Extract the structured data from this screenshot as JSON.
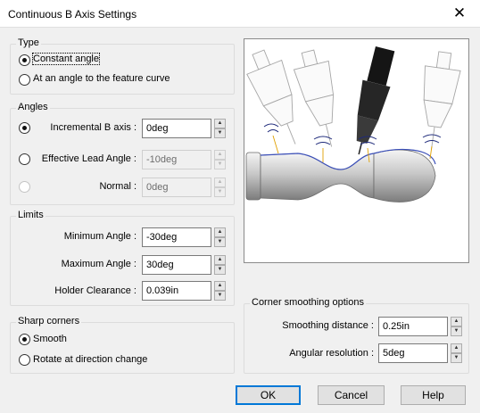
{
  "window": {
    "title": "Continuous B Axis Settings",
    "close_icon": "close-icon"
  },
  "type_group": {
    "label": "Type",
    "options": [
      {
        "label": "Constant angle",
        "checked": true
      },
      {
        "label": "At an angle to the feature curve",
        "checked": false
      }
    ]
  },
  "angles_group": {
    "label": "Angles",
    "incremental": {
      "label": "Incremental B axis :",
      "value": "0deg",
      "checked": true
    },
    "effective_lead": {
      "label": "Effective Lead Angle :",
      "value": "-10deg",
      "checked": false
    },
    "normal": {
      "label": "Normal :",
      "value": "0deg",
      "checked": false
    }
  },
  "limits_group": {
    "label": "Limits",
    "minimum": {
      "label": "Minimum Angle :",
      "value": "-30deg"
    },
    "maximum": {
      "label": "Maximum Angle :",
      "value": "30deg"
    },
    "holder": {
      "label": "Holder Clearance :",
      "value": "0.039in"
    }
  },
  "sharp_corners_group": {
    "label": "Sharp corners",
    "options": [
      {
        "label": "Smooth",
        "checked": true
      },
      {
        "label": "Rotate at direction change",
        "checked": false
      }
    ]
  },
  "corner_smoothing_group": {
    "label": "Corner smoothing options",
    "smoothing_distance": {
      "label": "Smoothing distance :",
      "value": "0.25in"
    },
    "angular_resolution": {
      "label": "Angular resolution :",
      "value": "5deg"
    }
  },
  "buttons": {
    "ok": "OK",
    "cancel": "Cancel",
    "help": "Help"
  },
  "colors": {
    "accent": "#0078d7",
    "window_bg": "#f0f0f0",
    "active_tool": "#1e1e1e"
  }
}
